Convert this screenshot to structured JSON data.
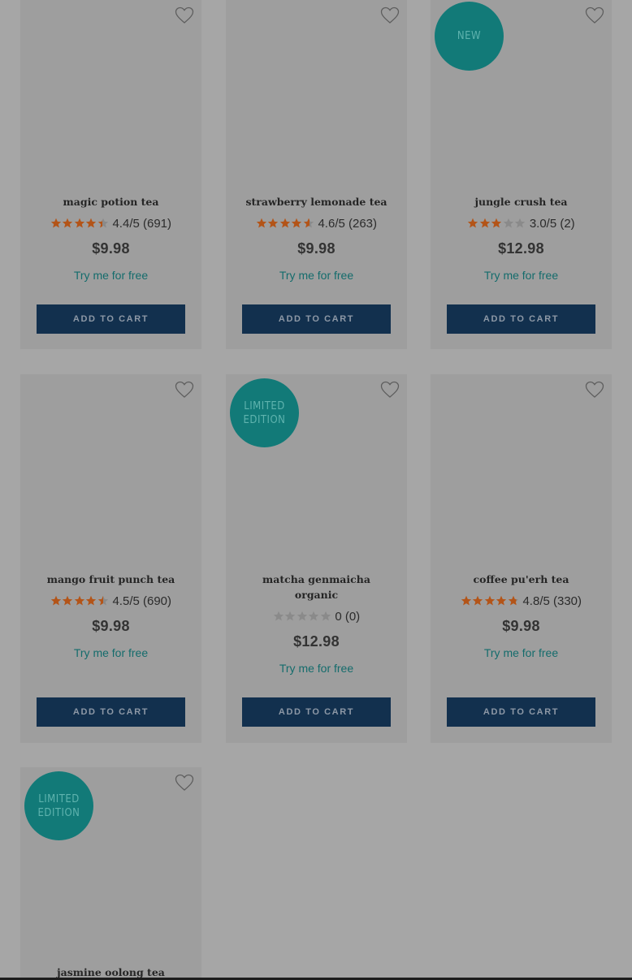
{
  "colors": {
    "overlay_background": "#a6a6a6",
    "card_background": "#9e9e9e",
    "badge": "#127a78",
    "star_filled": "#b35418",
    "star_empty": "#8a8a8a",
    "try_link": "#146c6c",
    "cart_button": "#12304e"
  },
  "products": [
    {
      "name": "magic potion tea",
      "rating_score": 4.4,
      "rating_text": "4.4/5 (691)",
      "price": "$9.98",
      "try_label": "Try me for free",
      "cart_label": "ADD TO CART",
      "badge": "",
      "favorite_icon": "heart-outline-icon"
    },
    {
      "name": "strawberry lemonade tea",
      "rating_score": 4.6,
      "rating_text": "4.6/5 (263)",
      "price": "$9.98",
      "try_label": "Try me for free",
      "cart_label": "ADD TO CART",
      "badge": "",
      "favorite_icon": "heart-outline-icon"
    },
    {
      "name": "jungle crush tea",
      "rating_score": 3.0,
      "rating_text": "3.0/5 (2)",
      "price": "$12.98",
      "try_label": "Try me for free",
      "cart_label": "ADD TO CART",
      "badge": "NEW",
      "favorite_icon": "heart-outline-icon"
    },
    {
      "name": "mango fruit punch tea",
      "rating_score": 4.5,
      "rating_text": "4.5/5 (690)",
      "price": "$9.98",
      "try_label": "Try me for free",
      "cart_label": "ADD TO CART",
      "badge": "",
      "favorite_icon": "heart-outline-icon"
    },
    {
      "name": "matcha genmaicha\norganic",
      "rating_score": 0,
      "rating_text": "0 (0)",
      "price": "$12.98",
      "try_label": "Try me for free",
      "cart_label": "ADD TO CART",
      "badge": "LIMITED\nEDITION",
      "favorite_icon": "heart-outline-icon"
    },
    {
      "name": "coffee pu'erh tea",
      "rating_score": 4.8,
      "rating_text": "4.8/5 (330)",
      "price": "$9.98",
      "try_label": "Try me for free",
      "cart_label": "ADD TO CART",
      "badge": "",
      "favorite_icon": "heart-outline-icon"
    },
    {
      "name": "jasmine oolong tea",
      "badge": "LIMITED\nEDITION",
      "favorite_icon": "heart-outline-icon"
    }
  ]
}
